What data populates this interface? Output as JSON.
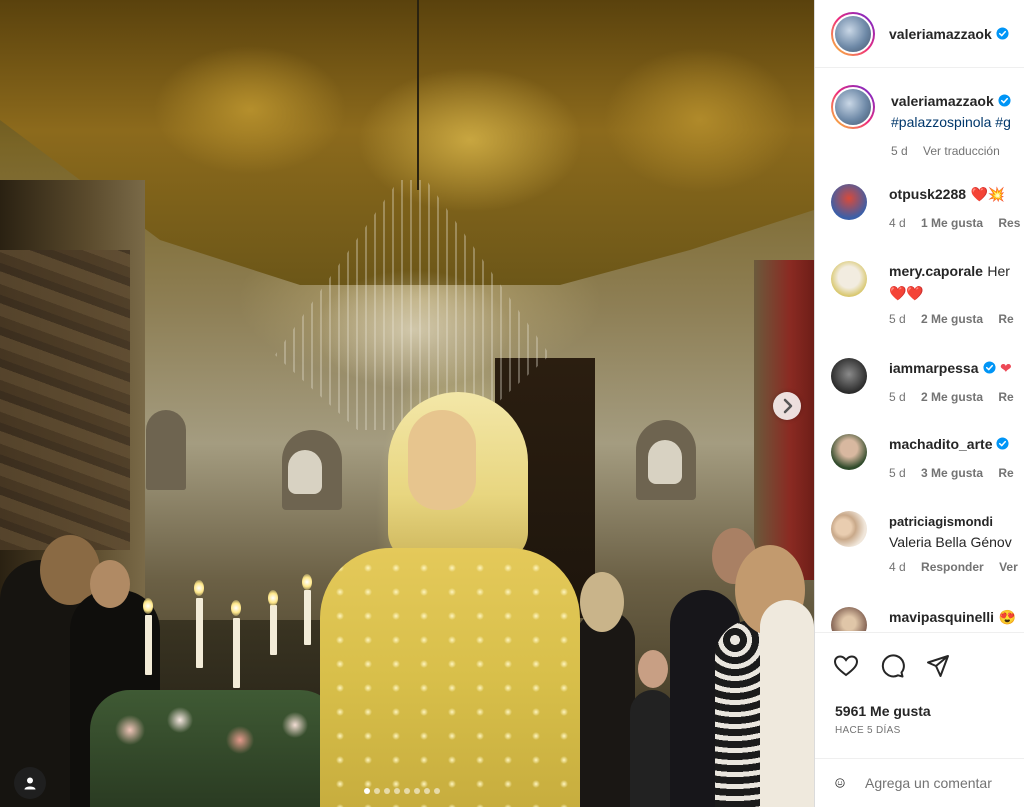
{
  "photo": {
    "alt_subject": "",
    "carousel_dots": 8,
    "active_dot": 0,
    "next_icon": "chevron-right-icon",
    "tag_icon": "user-tag-icon"
  },
  "header": {
    "username": "valeriamazzaok",
    "verified_icon": "verified-badge-icon"
  },
  "caption": {
    "username": "valeriamazzaok",
    "text": "#palazzospinola #g",
    "time": "5 d",
    "translate": "Ver traducción"
  },
  "comments": [
    {
      "username": "otpusk2288",
      "text": "❤️💥",
      "time": "4 d",
      "likes": "1 Me gusta",
      "reply": "Res",
      "verified": false,
      "avatar_color": "#3b5fa8"
    },
    {
      "username": "mery.caporale",
      "text": "Her",
      "text2": "❤️❤️",
      "time": "5 d",
      "likes": "2 Me gusta",
      "reply": "Re",
      "verified": false,
      "avatar_color": "#d9c870"
    },
    {
      "username": "iammarpessa",
      "text": "❤",
      "time": "5 d",
      "likes": "2 Me gusta",
      "reply": "Re",
      "verified": true,
      "avatar_color": "#3a3a3a"
    },
    {
      "username": "machadito_arte",
      "text": "",
      "time": "5 d",
      "likes": "3 Me gusta",
      "reply": "Re",
      "verified": true,
      "avatar_color": "#7a7a6a"
    },
    {
      "username": "patriciagismondi",
      "text": "",
      "text2": "Valeria Bella Génov",
      "time": "4 d",
      "likes": "Responder",
      "reply": "Ver",
      "verified": false,
      "avatar_color": "#c9a98a"
    },
    {
      "username": "mavipasquinelli",
      "text": "😍",
      "verified": false,
      "avatar_color": "#8a6a5a"
    }
  ],
  "actions": {
    "like_icon": "heart-icon",
    "comment_icon": "comment-icon",
    "share_icon": "share-icon",
    "likes_count": "5961 Me gusta",
    "date": "HACE 5 DÍAS"
  },
  "add_comment": {
    "emoji_icon": "emoji-icon",
    "placeholder": "Agrega un comentar"
  },
  "colors": {
    "verified": "#0095f6",
    "link": "#00376b",
    "muted": "#737373",
    "heart": "#ed4956"
  }
}
